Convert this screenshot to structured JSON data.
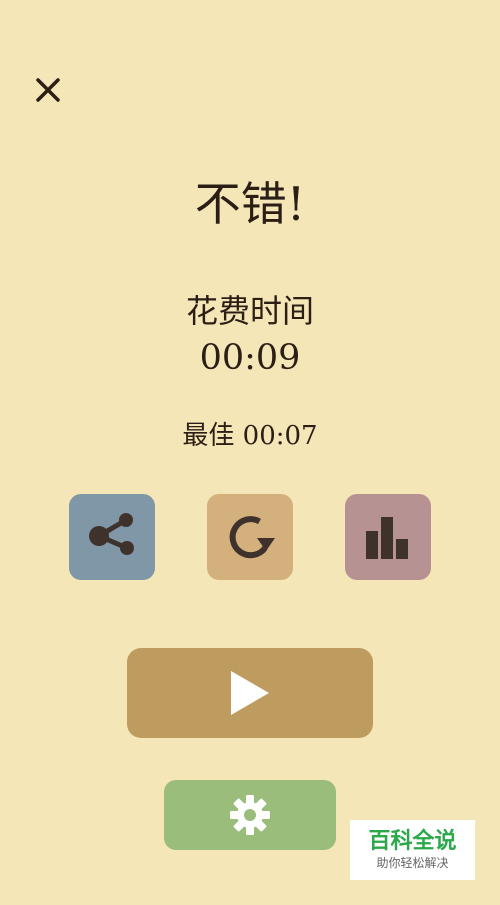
{
  "header": {
    "close_icon": "close-icon"
  },
  "result": {
    "title": "不错!",
    "time_label": "花费时间",
    "time_value": "00:09",
    "best": "最佳 00:07"
  },
  "actions": {
    "share": {
      "icon": "share-icon",
      "color": "#7f97a6"
    },
    "restart": {
      "icon": "restart-icon",
      "color": "#d4b07d"
    },
    "stats": {
      "icon": "bar-chart-icon",
      "color": "#b79292"
    },
    "play": {
      "icon": "play-icon",
      "color": "#be9c5f"
    },
    "settings": {
      "icon": "gear-icon",
      "color": "#9abd7b"
    }
  },
  "colors": {
    "background": "#f5e6b8",
    "text": "#2b1e14",
    "icon_dark": "#4a3a32"
  },
  "watermark": {
    "title": "百科全说",
    "subtitle": "助你轻松解决"
  }
}
